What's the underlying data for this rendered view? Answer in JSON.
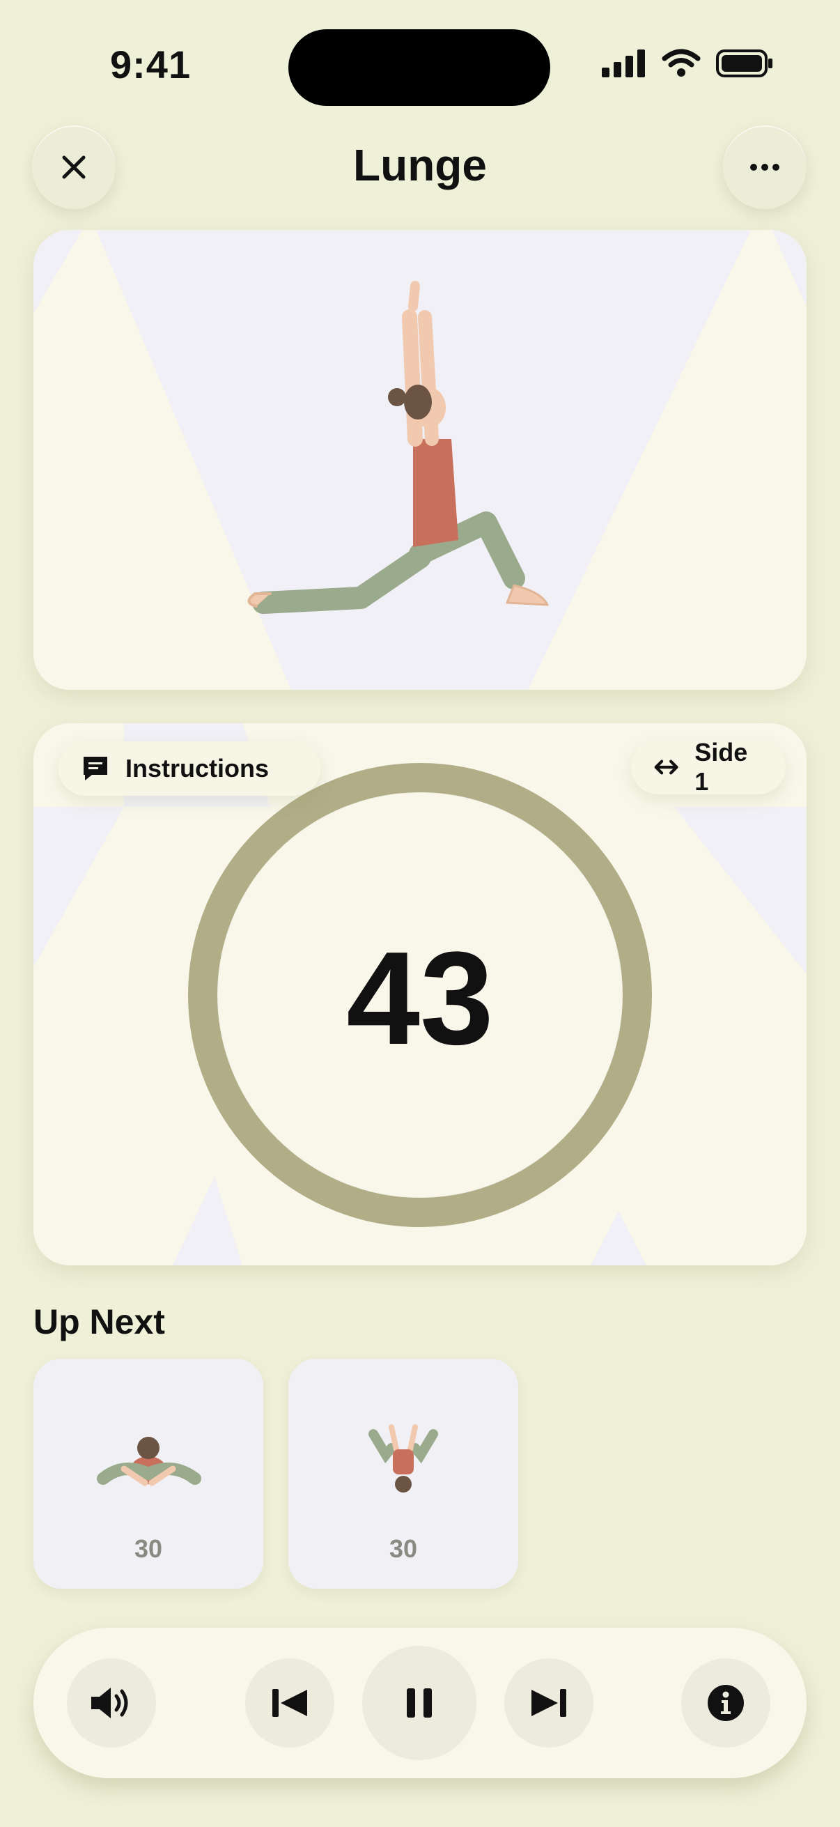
{
  "status": {
    "time": "9:41"
  },
  "header": {
    "title": "Lunge"
  },
  "timer": {
    "instructions_label": "Instructions",
    "side_label": "Side 1",
    "count": "43"
  },
  "up_next": {
    "title": "Up Next",
    "items": [
      {
        "duration": "30"
      },
      {
        "duration": "30"
      }
    ]
  },
  "colors": {
    "background": "#eff0d8",
    "ring": "#b0ad87",
    "card": "#f8f7ea",
    "lavender": "#f1f0f6"
  },
  "icons": {
    "close": "close-icon",
    "more": "ellipsis-icon",
    "instructions": "message-icon",
    "side": "arrows-left-right-icon",
    "volume": "speaker-icon",
    "previous": "skip-back-icon",
    "pause": "pause-icon",
    "next": "skip-forward-icon",
    "info": "info-icon"
  }
}
